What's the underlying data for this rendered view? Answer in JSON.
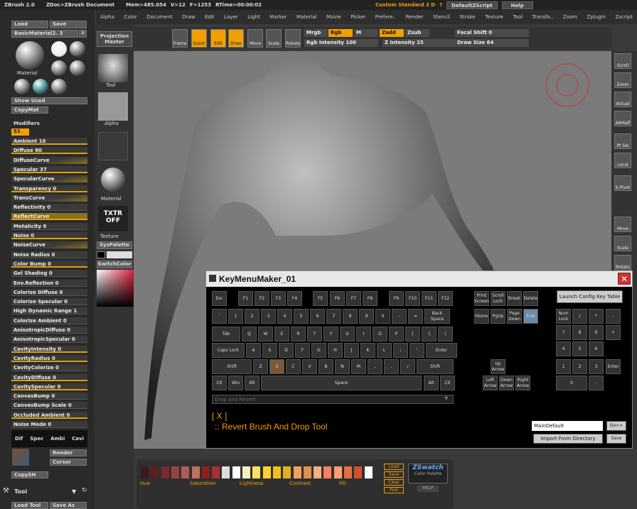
{
  "titlebar": {
    "app": "ZBrush 2.0",
    "doc": "ZDoc>ZBrush Document",
    "mem": "Mem>485.054",
    "v": "V>12",
    "f": "F>1253",
    "rtime": "RTime>00:00:02",
    "custom": "Custom Standard 2 D",
    "q": "?",
    "default_script": "DefaultZScript",
    "help": "Help"
  },
  "menu": [
    "Alpha",
    "Color",
    "Document",
    "Draw",
    "Edit",
    "Layer",
    "Light",
    "Marker",
    "Material",
    "Movie",
    "Picker",
    "Prefere..",
    "Render",
    "Stencil",
    "Stroke",
    "Texture",
    "Tool",
    "Transfo..",
    "Zoom",
    "Zplugin",
    "Zscript"
  ],
  "left": {
    "material_header": "Material",
    "load": "Load",
    "save": "Save",
    "material_name": "BasicMaterial2. 3",
    "r": "R",
    "material_label": "Material",
    "show_used": "Show Used",
    "copymat": "CopyMat",
    "modifiers": "Modifiers",
    "s1": "S1",
    "rows": [
      "Ambient 10",
      "Diffuse 80",
      "DiffuseCurve",
      "Specular 37",
      "SpecularCurve",
      "Transparency 0",
      "TransCurve",
      "Reflectivity 0",
      "ReflectCurve",
      "Metalicity 0",
      "Noise 0",
      "NoiseCurve",
      "Noise Radius 0",
      "Color Bump 0",
      "Gel Shading 0",
      "Env.Reflection 0",
      "Colorize Diffuse 0",
      "Colorize Specular 0",
      "High Dynamic Range 1",
      "Colorize Ambient 0",
      "AnisotropicDiffuse 0",
      "AnisotropicSpecular 0",
      "CavityIntensity 0",
      "CavityRadius 0",
      "CavityColorize 0",
      "CavityDiffuse 0",
      "CavitySpecular 0",
      "CanvasBump 0",
      "CanvasBump Scale 0",
      "Occluded Ambient 0",
      "Noise Mode 0"
    ],
    "tabs": [
      "Dif",
      "Spec",
      "Ambi",
      "Cavi"
    ],
    "render": "Render",
    "cursor": "Cursor",
    "copysh": "CopySH",
    "tool": "Tool",
    "load_tool": "Load Tool",
    "save_as": "Save As"
  },
  "toolcol": {
    "tool": "Tool",
    "alpha": "Alpha",
    "material": "Material",
    "txtr_off": "TXTR OFF",
    "texture": "Texture",
    "syspalette": "SysPalette",
    "switchcolor": "SwitchColor"
  },
  "shelf": {
    "projection_master": "Projection Master",
    "frame": "Frame",
    "quick": "Quick",
    "edit": "Edit",
    "draw": "Draw",
    "move": "Move",
    "scale": "Scale",
    "rotate": "Rotate",
    "mrgb": "Mrgb",
    "rgb": "Rgb",
    "m": "M",
    "zadd": "Zadd",
    "zsub": "Zsub",
    "rgb_intensity": "Rgb Intensity 100",
    "z_intensity": "Z Intensity 25",
    "focal_shift": "Focal Shift 0",
    "draw_size": "Draw Size 64"
  },
  "right": [
    "Scroll",
    "Zoom",
    "Actual",
    "AAHalf",
    "Pt Sel",
    "Local",
    "S.Pivot",
    "Move",
    "Scale",
    "Rotate"
  ],
  "dialog": {
    "title": "KeyMenuMaker_01",
    "close": "✕",
    "launch": "Launch Config Key Table",
    "dropdown": "Drop and Revert",
    "hotkey": "[ X ]",
    "desc": ":: Revert Brush And Drop Tool",
    "config_name": "MainDefault",
    "go": "Go>>",
    "import": "Import From Directory",
    "save": "Save",
    "fkeys": [
      "Esc",
      "F1",
      "F2",
      "F3",
      "F4",
      "F5",
      "F6",
      "F7",
      "F8",
      "F9",
      "F10",
      "F11",
      "F12"
    ],
    "row1": [
      "`",
      "1",
      "2",
      "3",
      "4",
      "5",
      "6",
      "7",
      "8",
      "9",
      "0",
      "-",
      "=",
      "Back Space"
    ],
    "row2": [
      "Tab",
      "Q",
      "W",
      "E",
      "R",
      "T",
      "Y",
      "U",
      "I",
      "O",
      "P",
      "[",
      "]",
      "\\"
    ],
    "row3": [
      "Caps Lock",
      "A",
      "S",
      "D",
      "F",
      "G",
      "H",
      "J",
      "K",
      "L",
      ";",
      "'",
      "Enter"
    ],
    "row4": [
      "Shift",
      "Z",
      "X",
      "C",
      "V",
      "B",
      "N",
      "M",
      ",",
      ".",
      "/",
      "Shift"
    ],
    "row5": [
      "Ctl",
      "Win",
      "Alt",
      "Space",
      "Alt",
      "Ctl"
    ],
    "nav1": [
      "Print Screen",
      "Scroll Lock",
      "Break",
      "Delete"
    ],
    "nav2": [
      "Home",
      "PgUp",
      "Page Down",
      "End"
    ],
    "arrows": [
      "Up Arrow",
      "Left Arrow",
      "Down Arrow",
      "Right Arrow"
    ],
    "numpad": [
      "Num Lock",
      "/",
      "*",
      "-",
      "7",
      "8",
      "9",
      "+",
      "4",
      "5",
      "6",
      "1",
      "2",
      "3",
      "Enter",
      "0",
      "."
    ]
  },
  "bottom": {
    "load": "Load",
    "save": "Save",
    "clear": "Clear",
    "pick": "Pick",
    "zswatch": "ZSwatch",
    "color_palette": "Color Palette",
    "help": "HELP",
    "hue": "Hue",
    "saturation": "Saturation",
    "lightness": "Lightness",
    "contrast": "Contrast",
    "fill": "Fill"
  },
  "colors": {
    "accent": "#f0a000",
    "swatches": [
      "#3a1a1a",
      "#5a2020",
      "#7a2a2a",
      "#9a4040",
      "#b05a5a",
      "#c07060",
      "#8a2020",
      "#aa3030",
      "#dddddd",
      "#ffffff",
      "#f0f0c0",
      "#ffe060",
      "#ffd030",
      "#f0c020",
      "#e0b020",
      "#f0a060",
      "#e09050",
      "#f0b080",
      "#ff8060",
      "#ffa070",
      "#e07040",
      "#d05030",
      "#ffffff"
    ]
  }
}
